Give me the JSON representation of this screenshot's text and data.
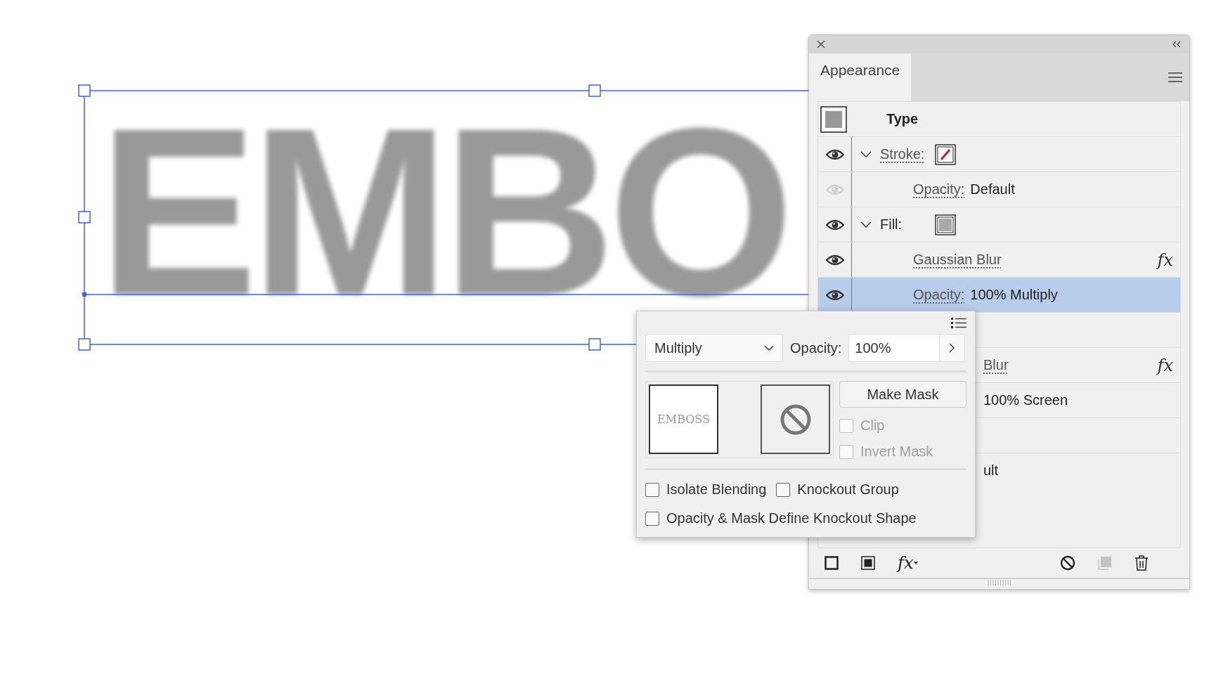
{
  "canvas": {
    "text": "EMBO"
  },
  "panel": {
    "tabs": [
      {
        "label": "Appearance",
        "selected": true
      }
    ],
    "rows": [
      {
        "kind": "header",
        "label": "Type",
        "selected": false
      },
      {
        "kind": "attribute",
        "label": "Stroke:",
        "linked": true,
        "visible": true,
        "expanded": true,
        "swatch": {
          "kind": "none"
        },
        "selected": false
      },
      {
        "kind": "property",
        "label": "Opacity:",
        "linked": true,
        "value": "Default",
        "visible": false,
        "selected": false
      },
      {
        "kind": "attribute",
        "label": "Fill:",
        "linked": false,
        "visible": true,
        "expanded": true,
        "swatch": {
          "kind": "solid",
          "color": "#a9a9a9"
        },
        "selected": false
      },
      {
        "kind": "effect",
        "label": "Gaussian Blur",
        "linked": true,
        "fx": "fx",
        "visible": true,
        "selected": false
      },
      {
        "kind": "property",
        "label": "Opacity:",
        "linked": true,
        "value": "100% Multiply",
        "visible": true,
        "selected": true
      },
      {
        "kind": "covered",
        "selected": false
      },
      {
        "kind": "covered",
        "text": "Blur",
        "linked": true,
        "fx": "fx",
        "selected": false
      },
      {
        "kind": "covered",
        "text": "100% Screen",
        "linked": false,
        "selected": false
      },
      {
        "kind": "covered",
        "selected": false
      },
      {
        "kind": "covered",
        "text": "ult",
        "linked": false,
        "selected": false
      }
    ],
    "toolbar": [
      {
        "kind": "add-stroke",
        "disabled": false
      },
      {
        "kind": "add-fill",
        "disabled": false
      },
      {
        "kind": "add-effect",
        "label": "fx",
        "disabled": false
      },
      {
        "kind": "clear",
        "disabled": false
      },
      {
        "kind": "duplicate",
        "disabled": true
      },
      {
        "kind": "delete",
        "disabled": false
      }
    ]
  },
  "popup": {
    "blend_mode": "Multiply",
    "opacity_label": "Opacity:",
    "opacity": "100%",
    "thumbnail_text": "EMBOSS",
    "make_mask": "Make Mask",
    "options": [
      {
        "label": "Clip",
        "checked": false,
        "disabled": true
      },
      {
        "label": "Invert Mask",
        "checked": false,
        "disabled": true
      },
      {
        "label": "Isolate Blending",
        "checked": false,
        "disabled": false
      },
      {
        "label": "Knockout Group",
        "checked": false,
        "disabled": false
      },
      {
        "label": "Opacity & Mask Define Knockout Shape",
        "checked": false,
        "disabled": false
      }
    ]
  }
}
